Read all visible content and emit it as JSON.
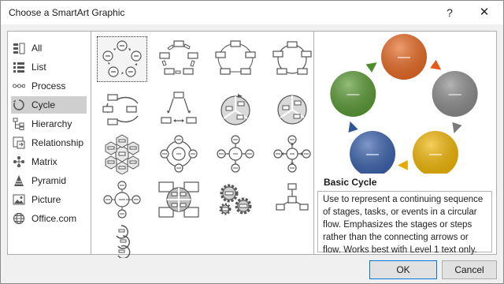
{
  "window": {
    "title": "Choose a SmartArt Graphic",
    "help_glyph": "?",
    "close_glyph": "✕"
  },
  "categories": [
    {
      "label": "All",
      "icon": "all-icon"
    },
    {
      "label": "List",
      "icon": "list-icon"
    },
    {
      "label": "Process",
      "icon": "process-icon"
    },
    {
      "label": "Cycle",
      "icon": "cycle-icon",
      "selected": true
    },
    {
      "label": "Hierarchy",
      "icon": "hierarchy-icon"
    },
    {
      "label": "Relationship",
      "icon": "relationship-icon"
    },
    {
      "label": "Matrix",
      "icon": "matrix-icon"
    },
    {
      "label": "Pyramid",
      "icon": "pyramid-icon"
    },
    {
      "label": "Picture",
      "icon": "picture-icon"
    },
    {
      "label": "Office.com",
      "icon": "globe-icon"
    }
  ],
  "gallery": {
    "selected_layout": "Basic Cycle",
    "layout_count": 17
  },
  "preview": {
    "name": "Basic Cycle",
    "description": "Use to represent a continuing sequence of stages, tasks, or events in a circular flow. Emphasizes the stages or steps rather than the connecting arrows or flow. Works best with Level 1 text only.",
    "node_label": "—",
    "colors": [
      "#e86a23",
      "#8c8c8c",
      "#f2b705",
      "#3a62ad",
      "#5a9a34"
    ],
    "arrow_colors": [
      "#e55a1b",
      "#7a7a7a",
      "#e8a800",
      "#2f5597",
      "#4f8e2c"
    ]
  },
  "buttons": {
    "ok": "OK",
    "cancel": "Cancel"
  }
}
